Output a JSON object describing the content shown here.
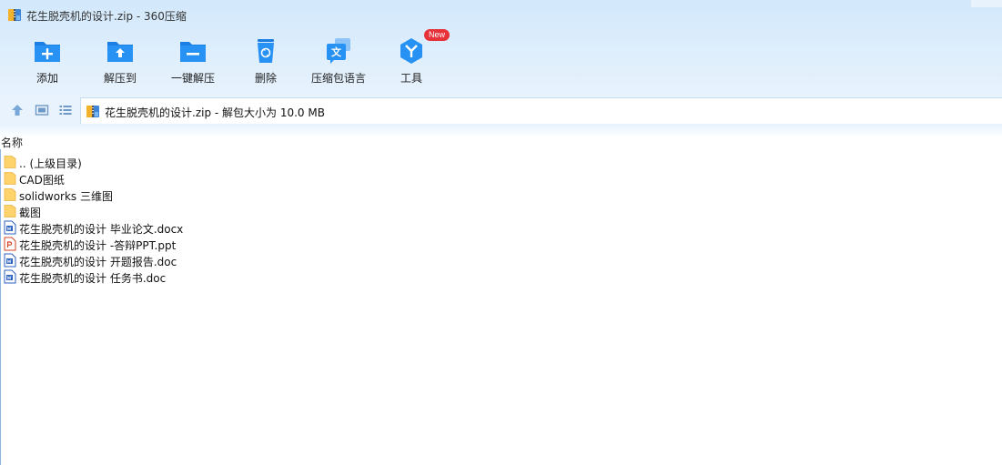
{
  "window": {
    "title": "花生脱壳机的设计.zip - 360压缩"
  },
  "toolbar": {
    "items": [
      {
        "label": "添加",
        "icon": "add-icon"
      },
      {
        "label": "解压到",
        "icon": "extract-to-icon"
      },
      {
        "label": "一键解压",
        "icon": "one-click-extract-icon"
      },
      {
        "label": "删除",
        "icon": "delete-icon"
      },
      {
        "label": "压缩包语言",
        "icon": "language-icon"
      },
      {
        "label": "工具",
        "icon": "tools-icon",
        "badge": "New"
      }
    ]
  },
  "address": {
    "text": "花生脱壳机的设计.zip - 解包大小为 10.0 MB"
  },
  "list": {
    "column_name": "名称",
    "rows": [
      {
        "name": ".. (上级目录)",
        "type": "folder"
      },
      {
        "name": "CAD图纸",
        "type": "folder"
      },
      {
        "name": "solidworks 三维图",
        "type": "folder"
      },
      {
        "name": "截图",
        "type": "folder"
      },
      {
        "name": "花生脱壳机的设计 毕业论文.docx",
        "type": "word"
      },
      {
        "name": "花生脱壳机的设计 -答辩PPT.ppt",
        "type": "ppt"
      },
      {
        "name": "花生脱壳机的设计 开题报告.doc",
        "type": "word"
      },
      {
        "name": "花生脱壳机的设计 任务书.doc",
        "type": "word"
      }
    ]
  },
  "colors": {
    "accent": "#1e8ef2",
    "folder": "#ffd36b",
    "badge": "#e8323a",
    "word": "#2b62c0",
    "ppt": "#d24625"
  }
}
